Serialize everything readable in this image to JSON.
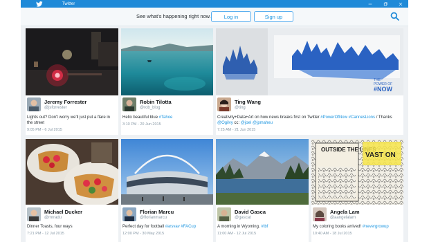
{
  "window": {
    "title": "Twitter"
  },
  "header": {
    "tagline": "See what's happening right now.",
    "login_label": "Log in",
    "signup_label": "Sign up"
  },
  "colors": {
    "brand": "#1f8ad8",
    "link": "#1b95e0",
    "muted": "#8899a6"
  },
  "tweets": [
    {
      "name": "Jeremy Forrester",
      "handle": "@jsforrester",
      "text": "Lights out? Don't worry we'll just put a flare in the street",
      "hashtags": [],
      "time": "9:05 PM - 6 Jul 2015"
    },
    {
      "name": "Robin Tilotta",
      "handle": "@rob_blog",
      "text": "Hello beautiful blue ",
      "hashtags": [
        "#Tahoe"
      ],
      "time": "3:10 PM - 20 Jun 2015"
    },
    {
      "name": "Ting Wang",
      "handle": "@ting",
      "text": "Creativity+Data+Art on how news breaks first on Twitter ",
      "hashtags": [
        "#PowerOfNow",
        "#CannesLions"
      ],
      "text_tail": " / Thanks ",
      "mentions": [
        "@Ogilvy",
        "@joel",
        "@jpmaheu"
      ],
      "text_cc": " cc: ",
      "time": "7:25 AM - 21 Jun 2015"
    },
    {
      "name": "Michael Ducker",
      "handle": "@mrradu",
      "text": "Dinner Toasts, four ways",
      "hashtags": [],
      "time": "7:21 PM - 12 Jul 2015"
    },
    {
      "name": "Florian Marcu",
      "handle": "@florianmarcu",
      "text": "Perfect day for football ",
      "hashtags": [
        "#arsvav",
        "#FACup"
      ],
      "time": "12:00 PM - 30 May 2015"
    },
    {
      "name": "David Gasca",
      "handle": "@gascat",
      "text": "A morning in Wyoming. ",
      "hashtags": [
        "#tbf"
      ],
      "time": "11:00 AM - 12 Jul 2015"
    },
    {
      "name": "Angela Lam",
      "handle": "@aangelalam",
      "text": "My coloring books arrived! ",
      "hashtags": [
        "#nevergrowup"
      ],
      "time": "10:40 AM - 18 Jul 2015"
    }
  ],
  "art_text": {
    "power_line1": "THE",
    "power_line2": "POWER OF",
    "power_line3": "#NOW",
    "book_title": "OUTSIDE THE LINES",
    "book_side": "VAST ON"
  }
}
